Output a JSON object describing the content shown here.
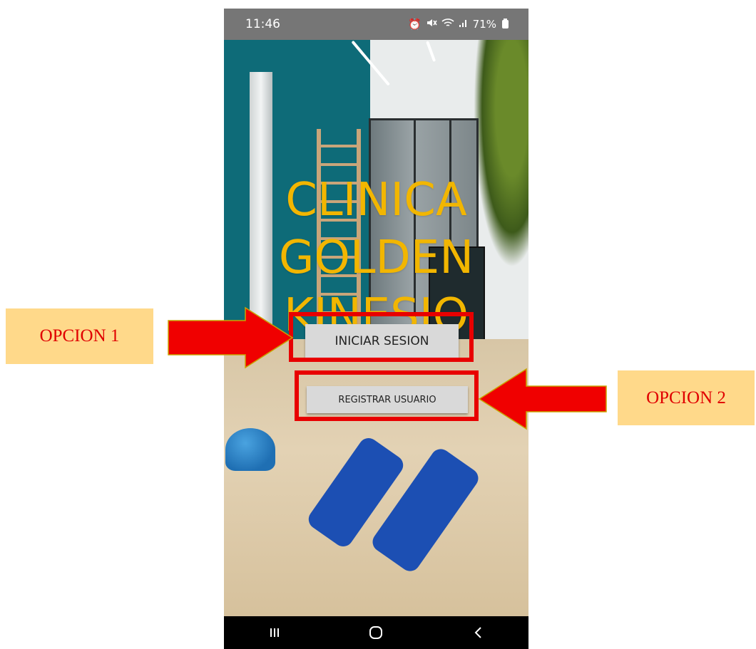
{
  "status_bar": {
    "time": "11:46",
    "battery": "71%",
    "icons": [
      "alarm-icon",
      "mute-icon",
      "wifi-icon",
      "signal-icon",
      "battery-icon"
    ]
  },
  "app": {
    "title_lines": [
      "CLINICA",
      "GOLDEN",
      "KINESIO"
    ],
    "title_color": "#f2b600",
    "login_button": "INICIAR SESION",
    "register_button": "REGISTRAR USUARIO"
  },
  "nav_bar": {
    "buttons": [
      "recent-apps-icon",
      "home-icon",
      "back-icon"
    ]
  },
  "annotations": {
    "option1_label": "OPCION 1",
    "option2_label": "OPCION 2",
    "highlight_color": "#e80000",
    "label_background": "#ffd98a"
  }
}
